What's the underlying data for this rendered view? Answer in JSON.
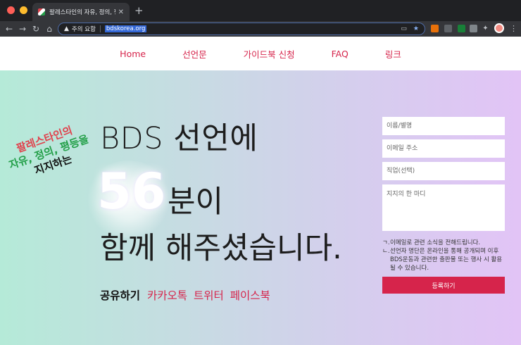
{
  "browser": {
    "tab_title": "팔레스타인의 자유, 정의, 평등을 지지",
    "new_tab_glyph": "+",
    "site_label": "주의 요함",
    "url": "bdskorea.org",
    "colors": {
      "close": "#ff5f57",
      "minimize": "#febc2e",
      "zoom": "#28c840"
    },
    "icons": [
      "back-arrow-icon",
      "forward-arrow-icon",
      "reload-icon",
      "home-icon",
      "warning-icon",
      "cast-icon",
      "star-icon",
      "extension-icon",
      "puzzle-icon",
      "profile-icon",
      "kebab-menu-icon"
    ]
  },
  "nav": {
    "items": [
      {
        "label": "Home"
      },
      {
        "label": "선언문"
      },
      {
        "label": "가이드북 신청"
      },
      {
        "label": "FAQ"
      },
      {
        "label": "링크"
      }
    ]
  },
  "hero": {
    "badge": {
      "line1": "팔레스타인의",
      "line2": "자유, 정의, 평등을",
      "line3": "지지하는"
    },
    "headline_line1": "BDS 선언에",
    "count": "56",
    "count_suffix": "분이",
    "headline_line3": "함께 해주셨습니다.",
    "share": {
      "title": "공유하기",
      "links": [
        "카카오톡",
        "트위터",
        "페이스북"
      ]
    }
  },
  "form": {
    "name_placeholder": "이름/별명",
    "email_placeholder": "이메일 주소",
    "job_placeholder": "직업(선택)",
    "message_placeholder": "지지의 한 마디",
    "notes": [
      {
        "mark": "ㄱ.",
        "text": "이메일로 관련 소식을 전해드립니다."
      },
      {
        "mark": "ㄴ.",
        "text": "선언자 명단은 온라인을 통해 공개되며 이후 BDS운동과 관련한 출판물 또는 행사 시 활용될 수 있습니다."
      }
    ],
    "submit_label": "등록하기"
  },
  "theme": {
    "accent": "#d6244b",
    "badge_red": "#e0434e",
    "badge_green": "#25a04a"
  }
}
